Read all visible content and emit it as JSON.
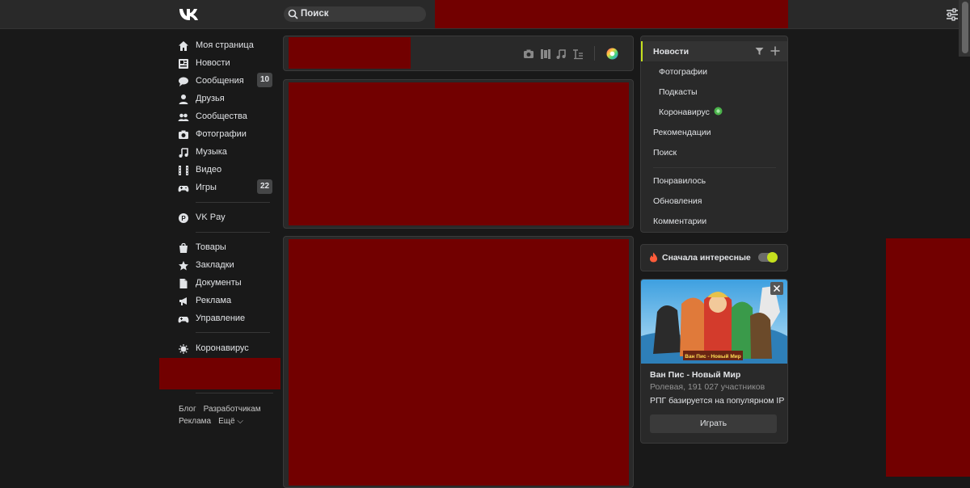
{
  "header": {
    "logo": "VK",
    "search_placeholder": "Поиск"
  },
  "nav": {
    "items": [
      {
        "label": "Моя страница",
        "icon": "home-icon"
      },
      {
        "label": "Новости",
        "icon": "news-icon"
      },
      {
        "label": "Сообщения",
        "icon": "messages-icon",
        "badge": "10"
      },
      {
        "label": "Друзья",
        "icon": "user-icon"
      },
      {
        "label": "Сообщества",
        "icon": "users-icon"
      },
      {
        "label": "Фотографии",
        "icon": "camera-icon"
      },
      {
        "label": "Музыка",
        "icon": "music-note-icon"
      },
      {
        "label": "Видео",
        "icon": "film-icon"
      },
      {
        "label": "Игры",
        "icon": "gamepad-icon",
        "badge": "22"
      },
      {
        "label": "VK Pay",
        "icon": "vkpay-icon"
      },
      {
        "label": "Товары",
        "icon": "bag-icon"
      },
      {
        "label": "Закладки",
        "icon": "star-icon"
      },
      {
        "label": "Документы",
        "icon": "document-icon"
      },
      {
        "label": "Реклама",
        "icon": "megaphone-icon"
      },
      {
        "label": "Управление",
        "icon": "gamepad-icon"
      },
      {
        "label": "Коронавирус",
        "icon": "virus-icon"
      }
    ],
    "footer": {
      "row1": [
        "Блог",
        "Разработчикам"
      ],
      "row2": [
        "Реклама",
        "Ещё ⌵"
      ]
    }
  },
  "feed_menu": {
    "active": "Новости",
    "subitems": [
      "Фотографии",
      "Подкасты",
      "Коронавирус"
    ],
    "items": [
      "Рекомендации",
      "Поиск"
    ],
    "items2": [
      "Понравилось",
      "Обновления",
      "Комментарии"
    ]
  },
  "interesting_toggle": {
    "label": "Сначала интересные",
    "on": true
  },
  "ad": {
    "image_title": "Ван Пис - Новый Мир",
    "title": "Ван Пис - Новый Мир",
    "meta": "Ролевая, 191 027 участников",
    "description": "РПГ базируется на популярном IP",
    "button": "Играть"
  },
  "colors": {
    "accent": "#c5e01e",
    "redaction": "#720000",
    "background": "#191919",
    "panel": "#292929"
  }
}
